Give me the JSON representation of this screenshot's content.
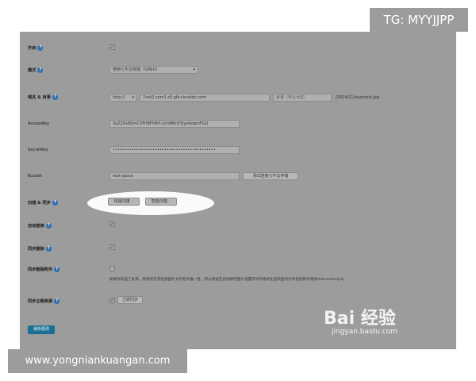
{
  "overlay": {
    "tg_label": "TG: MYYJJPP",
    "website": "www.yongniankuangan.com"
  },
  "form": {
    "enable": {
      "label": "开启",
      "checked": true
    },
    "mode": {
      "label": "模式",
      "value": "使用七牛云存储（QINIU）"
    },
    "domain": {
      "label": "域名 & 目录",
      "protocol": "http://",
      "domain_value": "7xxt2.com1.z0.glb.clouddn.com",
      "dir_placeholder": "目录（可以为空）",
      "path_example": "/2014/11/example.jpg"
    },
    "access_key": {
      "label": "AccessKey",
      "value": "3yZ25x8DmC3FrlBFhBH-2znMBn5YJye6dqmFGU"
    },
    "secret_key": {
      "label": "SecretKey",
      "value": "••••••••••••••••••••••••••••••••••••••••••••"
    },
    "bucket": {
      "label": "Bucket",
      "value": "test-space",
      "test_button": "测试连接七牛云存储"
    },
    "scan_sync": {
      "label": "扫描 & 同步",
      "quick_scan": "快速扫描",
      "smart_scan": "智能扫描"
    },
    "auto_replace": {
      "label": "自动替换",
      "checked": true
    },
    "sync_delete": {
      "label": "同步删除",
      "checked": true
    },
    "sync_delete_attach": {
      "label": "同步删除附件",
      "checked": false,
      "note": "如果你勾选了此项，系统将无法检测图片文件名的唯一性，所以建议在自动保存图片设置页中的格式化选项里的文件名结构中添加%timestamp%。"
    },
    "sync_theme": {
      "label": "同步主题资源",
      "checked": true,
      "button": "立即同步"
    },
    "save_button": "保存更改"
  },
  "watermark": {
    "logo": "Bai 经验",
    "sub": "jingyan.baidu.com"
  },
  "icons": {
    "help": "question-icon",
    "check": "checkmark-icon"
  }
}
